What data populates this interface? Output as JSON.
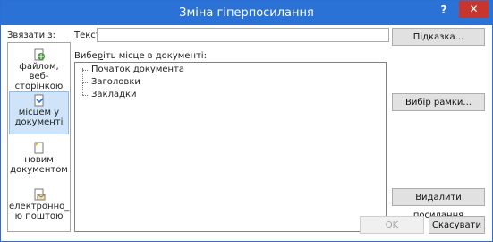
{
  "dialog": {
    "title": "Зміна гіперпосилання",
    "help": "?",
    "close": "✕"
  },
  "link_to": {
    "label_pre": "Зв",
    "label_acc": "я",
    "label_post": "зати з:",
    "items": [
      {
        "line1": "файлом, веб-",
        "line2": "сторінкою",
        "icon": "file-web-icon",
        "active": false
      },
      {
        "line1": "місцем у",
        "line2": "документі",
        "icon": "document-place-icon",
        "active": true
      },
      {
        "line1": "новим",
        "line2": "документом",
        "icon": "new-document-icon",
        "active": false
      },
      {
        "line1": "електронно_",
        "line2": "ю поштою",
        "icon": "email-icon",
        "active": false
      }
    ]
  },
  "text_field": {
    "label_acc": "Т",
    "label_rest": "екст:",
    "value": ""
  },
  "buttons": {
    "tooltip": "Підказка...",
    "target_frame": "Вибір рамки...",
    "remove_link": "Видалити посилання",
    "ok": "OK",
    "cancel": "Скасувати"
  },
  "place": {
    "label_pre": "Вибе",
    "label_acc": "р",
    "label_post": "іть місце в документі:",
    "items": [
      "Початок документа",
      "Заголовки",
      "Закладки"
    ]
  },
  "colors": {
    "titlebar": "#2a72d6",
    "close": "#c7352d",
    "selected": "#cfe4f8"
  }
}
